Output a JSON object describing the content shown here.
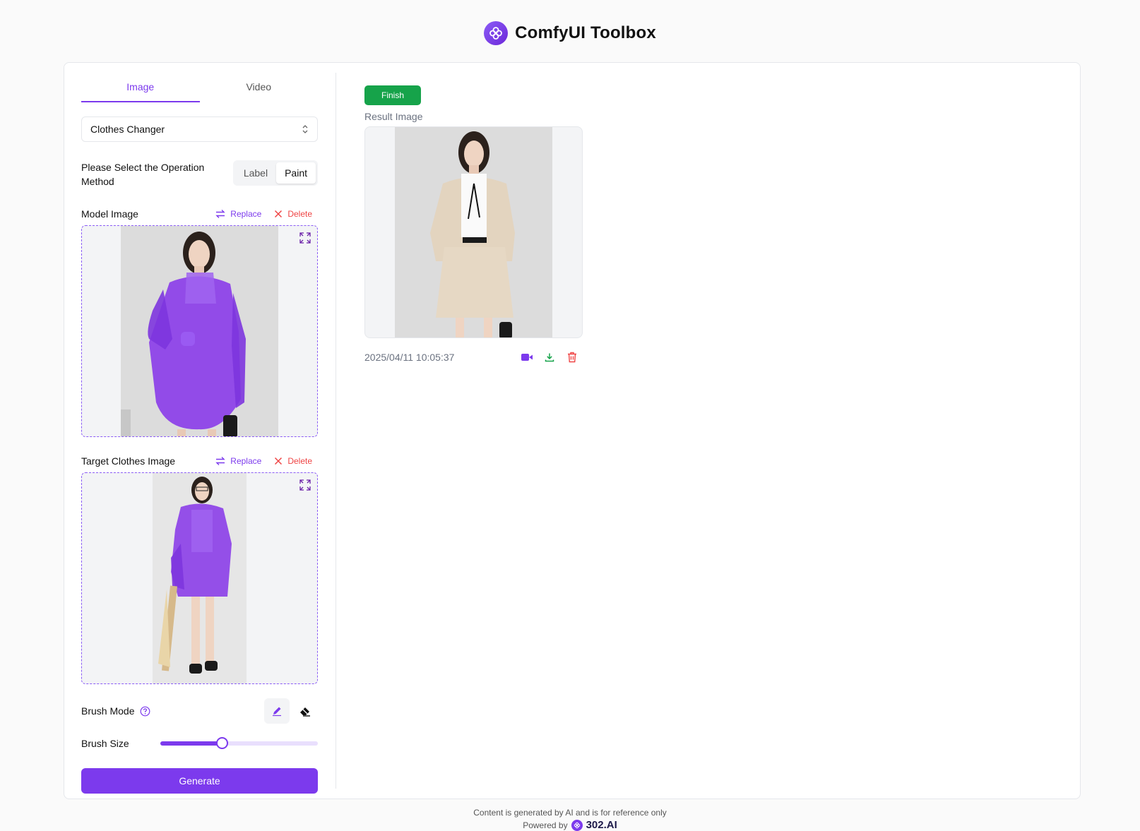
{
  "header": {
    "title": "ComfyUI Toolbox",
    "logo_icon": "clover-logo-icon",
    "accent": "#7c3aed"
  },
  "tabs": [
    {
      "label": "Image",
      "active": true
    },
    {
      "label": "Video",
      "active": false
    }
  ],
  "tool_select": {
    "value": "Clothes Changer"
  },
  "operation": {
    "label": "Please Select the Operation Method",
    "options": [
      "Label",
      "Paint"
    ],
    "selected": "Paint"
  },
  "model_image": {
    "title": "Model Image",
    "replace_label": "Replace",
    "delete_label": "Delete"
  },
  "target_image": {
    "title": "Target Clothes Image",
    "replace_label": "Replace",
    "delete_label": "Delete"
  },
  "brush": {
    "mode_label": "Brush Mode",
    "size_label": "Brush Size",
    "size_fraction": 0.39,
    "modes": [
      "pencil-icon",
      "eraser-icon"
    ],
    "active_mode": "pencil-icon"
  },
  "generate_label": "Generate",
  "result": {
    "status_label": "Finish",
    "status_color": "#16a34a",
    "title": "Result Image",
    "timestamp": "2025/04/11 10:05:37",
    "icons": [
      "video-icon",
      "download-icon",
      "trash-icon"
    ]
  },
  "footer": {
    "disclaimer": "Content is generated by AI and is for reference only",
    "powered_by": "Powered by",
    "brand": "302.AI"
  }
}
